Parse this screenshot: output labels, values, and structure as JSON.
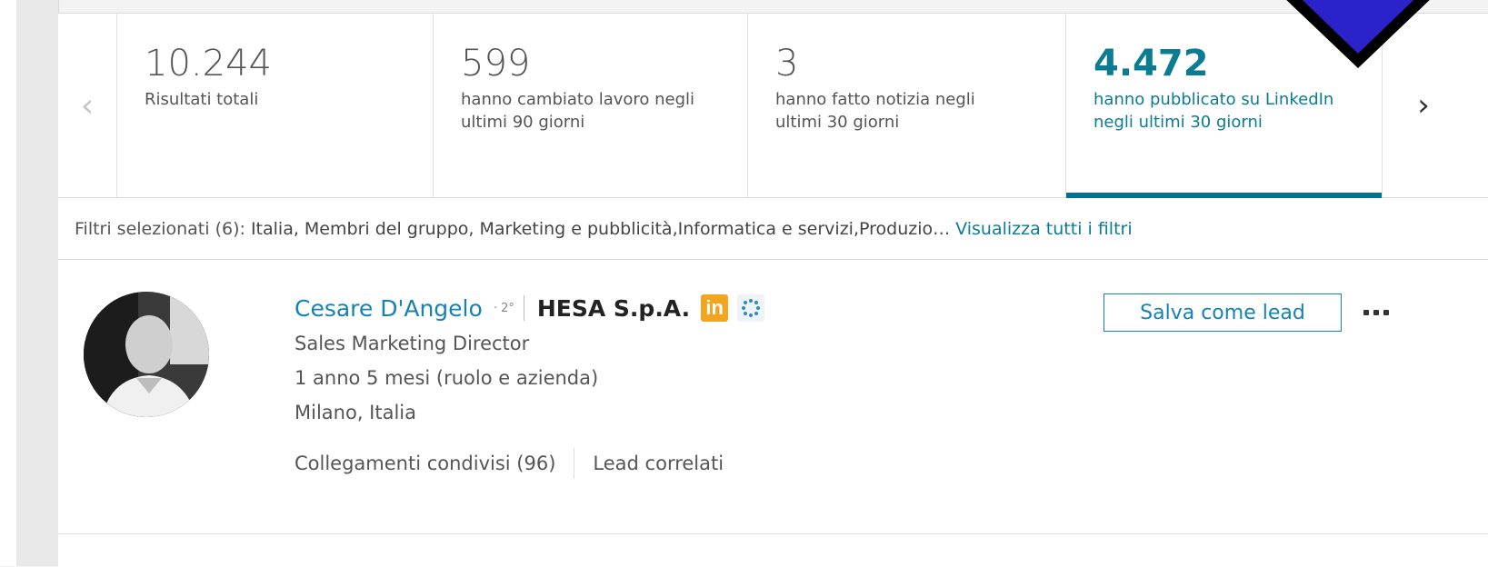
{
  "stats": {
    "items": [
      {
        "value": "10.244",
        "label": "Risultati totali"
      },
      {
        "value": "599",
        "label": "hanno cambiato lavoro negli ultimi 90 giorni"
      },
      {
        "value": "3",
        "label": "hanno fatto notizia negli ultimi 30 giorni"
      },
      {
        "value": "4.472",
        "label": "hanno pubblicato su LinkedIn negli ultimi 30 giorni"
      }
    ],
    "prev_glyph": "‹",
    "next_glyph": "›",
    "active_color": "#0b7c92"
  },
  "filters": {
    "label": "Filtri selezionati (6):",
    "values": "Italia, Membri del gruppo, Marketing e pubblicità,Informatica e servizi,Produzio…",
    "view_all": "Visualizza tutti i filtri"
  },
  "lead": {
    "name": "Cesare D'Angelo",
    "degree": "· 2°",
    "company": "HESA S.p.A.",
    "company_badge": "in",
    "title": "Sales Marketing Director",
    "tenure": "1 anno 5 mesi (ruolo e azienda)",
    "location": "Milano, Italia",
    "shared_connections": "Collegamenti condivisi (96)",
    "related_leads": "Lead correlati",
    "save_button": "Salva come lead",
    "link_color": "#1582b6"
  }
}
